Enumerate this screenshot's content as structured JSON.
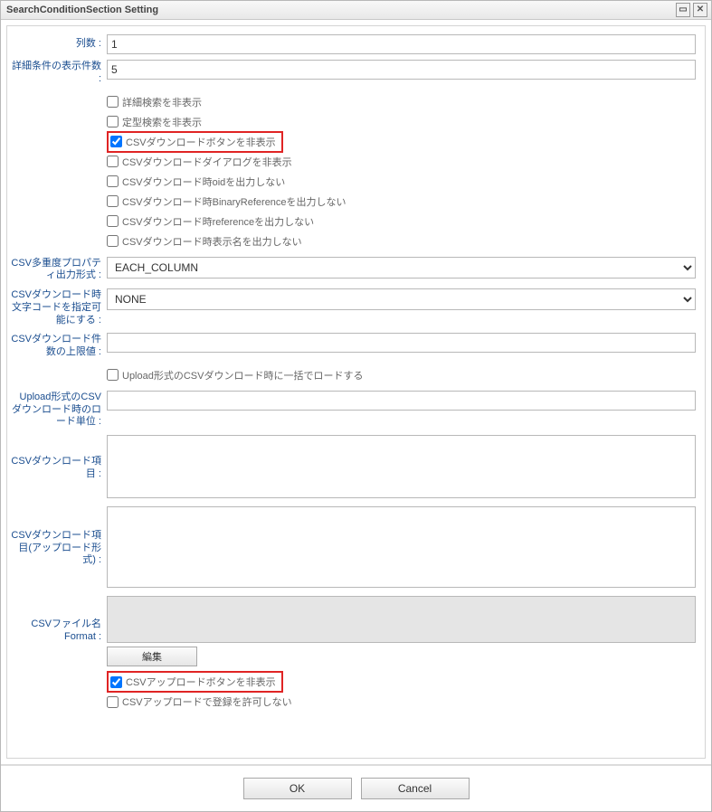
{
  "window": {
    "title": "SearchConditionSection Setting"
  },
  "fields": {
    "columns": {
      "label": "列数 :",
      "value": "1"
    },
    "detail_count": {
      "label": "詳細条件の表示件数 :",
      "value": "5"
    },
    "checks": {
      "hide_detail_search": "詳細検索を非表示",
      "hide_fixed_search": "定型検索を非表示",
      "hide_csv_dl_button": "CSVダウンロードボタンを非表示",
      "hide_csv_dl_dialog": "CSVダウンロードダイアログを非表示",
      "csv_no_oid": "CSVダウンロード時oidを出力しない",
      "csv_no_binref": "CSVダウンロード時BinaryReferenceを出力しない",
      "csv_no_ref": "CSVダウンロード時referenceを出力しない",
      "csv_no_dispname": "CSVダウンロード時表示名を出力しない"
    },
    "multiplicity": {
      "label": "CSV多重度プロパティ出力形式 :",
      "value": "EACH_COLUMN"
    },
    "charset": {
      "label": "CSVダウンロード時文字コードを指定可能にする :",
      "value": "NONE"
    },
    "limit": {
      "label": "CSVダウンロード件数の上限値 :",
      "value": ""
    },
    "upload_batch_check": "Upload形式のCSVダウンロード時に一括でロードする",
    "upload_unit": {
      "label": "Upload形式のCSVダウンロード時のロード単位 :",
      "value": ""
    },
    "csv_dl_items": {
      "label": "CSVダウンロード項目 :"
    },
    "csv_dl_items_upload": {
      "label": "CSVダウンロード項目(アップロード形式) :"
    },
    "csv_filename": {
      "label": "CSVファイル名Format :",
      "edit_label": "編集"
    },
    "hide_csv_upload_button": "CSVアップロードボタンを非表示",
    "disallow_csv_upload_register": "CSVアップロードで登録を許可しない"
  },
  "footer": {
    "ok": "OK",
    "cancel": "Cancel"
  }
}
